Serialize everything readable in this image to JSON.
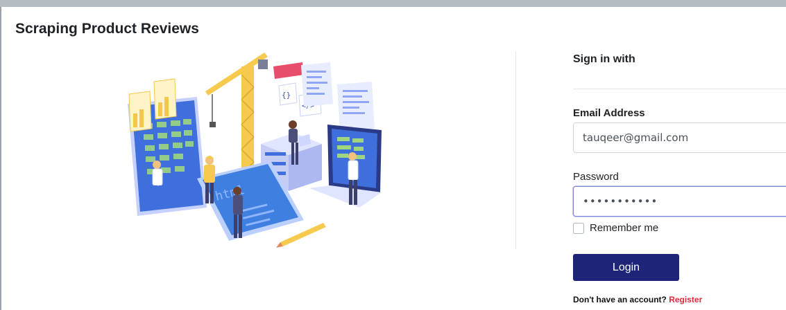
{
  "app": {
    "title": "Scraping Product Reviews"
  },
  "form": {
    "heading": "Sign in with",
    "email_label": "Email Address",
    "email_value": "tauqeer@gmail.com",
    "password_label": "Password",
    "password_value": "•••••••••••",
    "remember_label": "Remember me",
    "login_label": "Login",
    "no_account_text": "Don't have an account?",
    "register_label": "Register"
  },
  "illustration": {
    "code_tags": [
      "{ }",
      "</>",
      "html"
    ]
  },
  "colors": {
    "primary": "#1e2478",
    "accent_red": "#e0283c",
    "illus_blue": "#3f7fe0",
    "illus_yellow": "#f6c94f"
  }
}
